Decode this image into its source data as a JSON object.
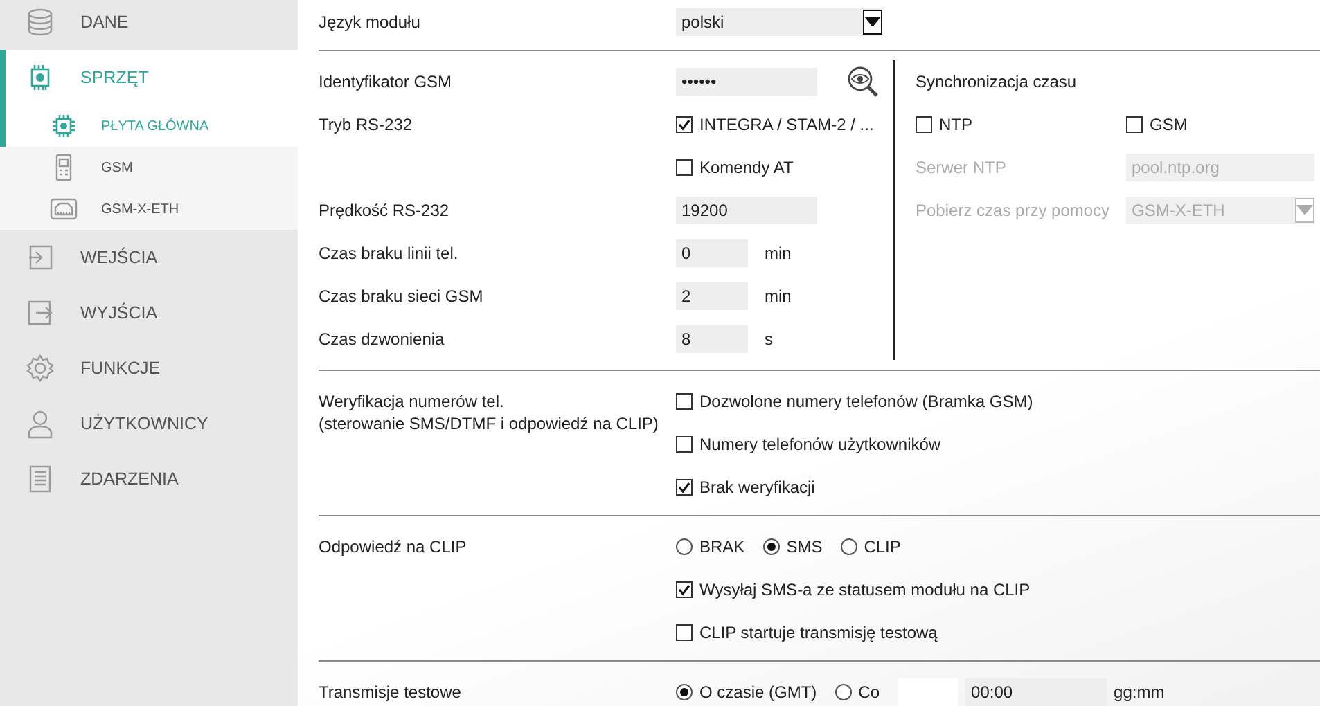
{
  "sidebar": {
    "items": [
      {
        "label": "DANE",
        "selected": false
      },
      {
        "label": "SPRZĘT",
        "selected": true,
        "expanded": true,
        "children": [
          {
            "label": "PŁYTA GŁÓWNA",
            "selected": true
          },
          {
            "label": "GSM",
            "selected": false
          },
          {
            "label": "GSM-X-ETH",
            "selected": false
          }
        ]
      },
      {
        "label": "WEJŚCIA",
        "selected": false
      },
      {
        "label": "WYJŚCIA",
        "selected": false
      },
      {
        "label": "FUNKCJE",
        "selected": false
      },
      {
        "label": "UŻYTKOWNICY",
        "selected": false
      },
      {
        "label": "ZDARZENIA",
        "selected": false
      }
    ]
  },
  "form": {
    "sections": [
      {
        "rows": [
          {
            "kind": "select",
            "label": "Język modułu",
            "value": "polski"
          }
        ]
      },
      {
        "rows": [
          {
            "kind": "password",
            "label": "Identyfikator GSM",
            "value": "••••••"
          },
          {
            "kind": "checkbox",
            "label": "Tryb RS-232",
            "option": "INTEGRA / STAM-2 / ...",
            "checked": true
          },
          {
            "kind": "checkbox",
            "option": "Komendy AT",
            "checked": false
          },
          {
            "kind": "text",
            "label": "Prędkość RS-232",
            "value": "19200"
          },
          {
            "kind": "number",
            "label": "Czas braku linii tel.",
            "value": "0",
            "unit": "min"
          },
          {
            "kind": "number",
            "label": "Czas braku sieci GSM",
            "value": "2",
            "unit": "min"
          },
          {
            "kind": "number",
            "label": "Czas dzwonienia",
            "value": "8",
            "unit": "s"
          }
        ],
        "side": {
          "title": "Synchronizacja czasu",
          "options": [
            {
              "label": "NTP",
              "checked": false
            },
            {
              "label": "GSM",
              "checked": false
            }
          ],
          "rows": [
            {
              "kind": "text",
              "label": "Serwer NTP",
              "value": "pool.ntp.org",
              "disabled": true
            },
            {
              "kind": "select",
              "label": "Pobierz czas przy pomocy",
              "value": "GSM-X-ETH",
              "disabled": true
            }
          ]
        }
      },
      {
        "rows": [
          {
            "kind": "checkbox",
            "label": "Weryfikacja numerów tel.",
            "note": "(sterowanie SMS/DTMF i odpowiedź na CLIP)",
            "option": "Dozwolone numery telefonów (Bramka GSM)",
            "checked": false
          },
          {
            "kind": "checkbox",
            "option": "Numery telefonów użytkowników",
            "checked": false
          },
          {
            "kind": "checkbox",
            "option": "Brak weryfikacji",
            "checked": true
          }
        ]
      },
      {
        "rows": [
          {
            "kind": "radios",
            "label": "Odpowiedź na CLIP",
            "options": [
              {
                "label": "BRAK",
                "selected": false
              },
              {
                "label": "SMS",
                "selected": true
              },
              {
                "label": "CLIP",
                "selected": false
              }
            ]
          },
          {
            "kind": "checkbox",
            "option": "Wysyłaj SMS-a ze statusem modułu na CLIP",
            "checked": true
          },
          {
            "kind": "checkbox",
            "option": "CLIP startuje transmisję testową",
            "checked": false
          }
        ]
      },
      {
        "rows": [
          {
            "kind": "schedule",
            "label": "Transmisje testowe",
            "options": [
              {
                "label": "O czasie (GMT)",
                "selected": true
              },
              {
                "label": "Co",
                "selected": false
              }
            ],
            "value": "00:00",
            "unit": "gg:mm"
          }
        ]
      }
    ]
  }
}
